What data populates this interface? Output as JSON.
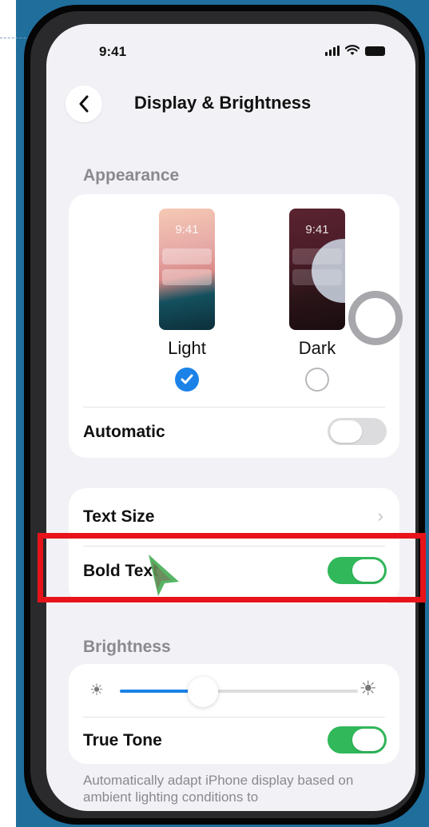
{
  "status_bar": {
    "time": "9:41"
  },
  "nav": {
    "title": "Display & Brightness",
    "back_icon": "chevron-left-icon"
  },
  "appearance": {
    "header": "Appearance",
    "options": [
      {
        "label": "Light",
        "preview_time": "9:41",
        "selected": true
      },
      {
        "label": "Dark",
        "preview_time": "9:41",
        "selected": false
      }
    ],
    "automatic_label": "Automatic",
    "automatic_on": false
  },
  "text_settings": {
    "text_size_label": "Text Size",
    "bold_text_label": "Bold Text",
    "bold_text_on": true
  },
  "brightness": {
    "header": "Brightness",
    "level": 0.35,
    "true_tone_label": "True Tone",
    "true_tone_on": true,
    "footnote": "Automatically adapt iPhone display based on ambient lighting conditions to"
  },
  "overlay": {
    "highlight_color": "#e8131a",
    "cursor_color": "#3aa84a"
  },
  "colors": {
    "accent_blue": "#1b82e8",
    "toggle_green": "#30b85a",
    "frame_blue": "#1f6e9c"
  }
}
